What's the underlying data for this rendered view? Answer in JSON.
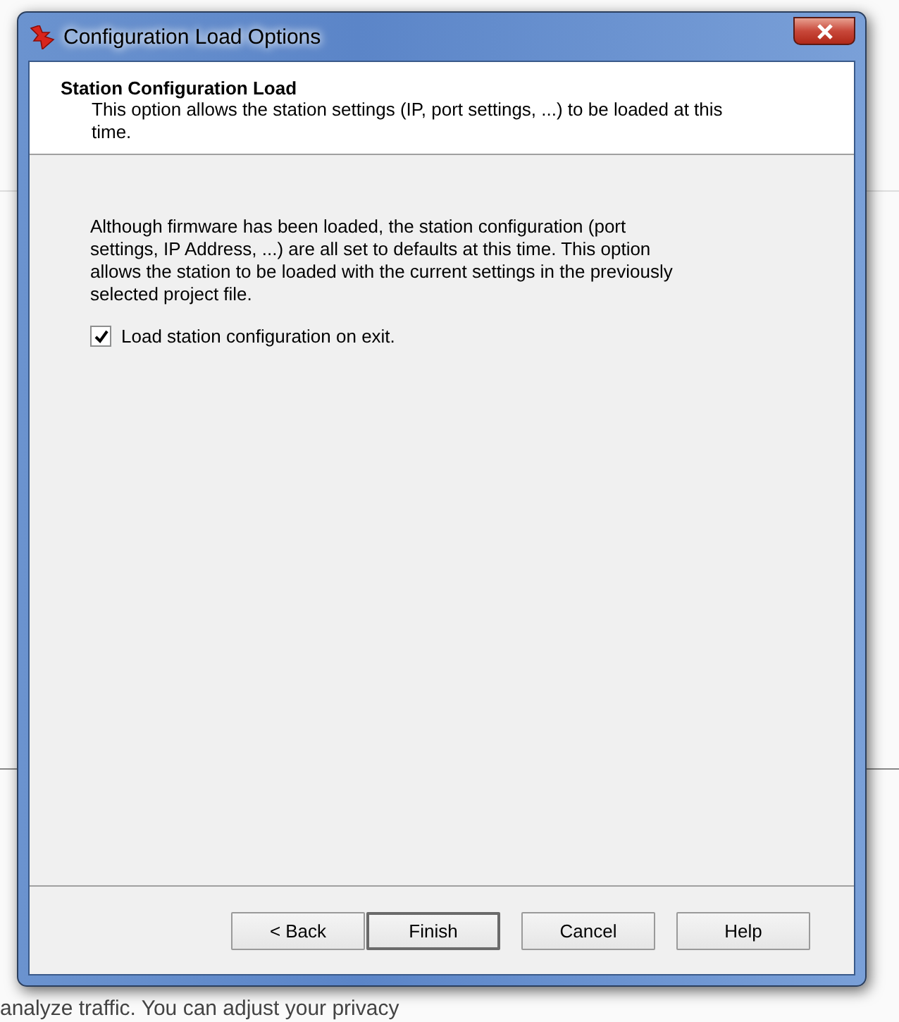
{
  "window": {
    "title": "Configuration Load Options"
  },
  "header": {
    "title": "Station Configuration Load",
    "description": "This option allows the station settings (IP, port settings, ...) to be loaded at this time."
  },
  "body": {
    "message": "Although firmware has been loaded, the station configuration (port settings, IP Address, ...) are all set to defaults at this time. This option allows the station to be loaded with the current settings in the previously selected project file.",
    "checkbox": {
      "label": "Load station configuration on exit.",
      "checked": true
    }
  },
  "buttons": [
    {
      "label": "< Back",
      "default": false
    },
    {
      "label": "Finish",
      "default": true
    },
    {
      "label": "Cancel",
      "default": false
    },
    {
      "label": "Help",
      "default": false
    }
  ],
  "background_text": "analyze traffic. You can adjust your privacy"
}
